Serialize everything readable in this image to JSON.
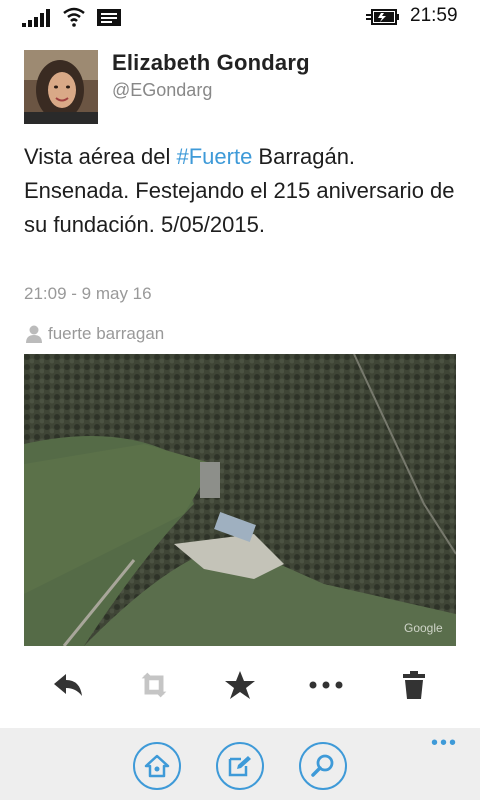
{
  "status_bar": {
    "time": "21:59"
  },
  "tweet": {
    "author_name": "Elizabeth Gondarg",
    "author_handle": "@EGondarg",
    "text_before": "Vista aérea del ",
    "hashtag": "#Fuerte",
    "text_after": " Barragán. Ensenada. Festejando el 215 aniversario de su fundación. 5/05/2015.",
    "timestamp": "21:09 - 9 may 16",
    "location": "fuerte barragan",
    "media_watermark": "Google"
  },
  "actions": [
    "reply-icon",
    "retweet-icon",
    "favorite-icon",
    "more-icon",
    "delete-icon"
  ],
  "app_bar": {
    "more_label": "•••",
    "buttons": [
      "home-icon",
      "compose-icon",
      "search-icon"
    ]
  },
  "colors": {
    "accent": "#3e9ad8",
    "hashtag": "#3e9ad8",
    "app_bar_bg": "#eeeeee"
  }
}
